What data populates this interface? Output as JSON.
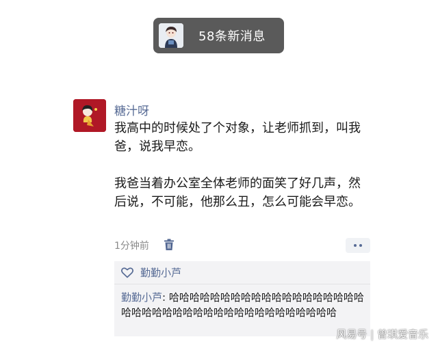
{
  "notice": {
    "new_messages_label": "58条新消息",
    "avatar_icon": "avatar-cartoon-icon"
  },
  "post": {
    "author": "糖汁呀",
    "paragraphs": [
      "我高中的时候处了个对象，让老师抓到，叫我爸，说我早恋。",
      "我爸当着办公室全体老师的面笑了好几声，然后说，不可能，他那么丑，怎么可能会早恋。"
    ],
    "time": "1分钟前",
    "delete_icon": "trash-icon",
    "more_icon": "more-dots-icon"
  },
  "interactions": {
    "like_icon": "heart-icon",
    "likes": "勤勤小芦",
    "comments": [
      {
        "name": "勤勤小芦",
        "separator": ": ",
        "text": "哈哈哈哈哈哈哈哈哈哈哈哈哈哈哈哈哈哈哈哈哈哈哈哈哈哈哈哈哈哈哈哈哈哈哈哈哈哈哈哈"
      }
    ]
  },
  "watermark": "风易号 | 曾琪爱音乐",
  "colors": {
    "link_blue": "#576b95",
    "pill_bg": "#5a5a5a",
    "panel_bg": "#f3f3f5",
    "author_avatar_bg": "#b01826"
  }
}
